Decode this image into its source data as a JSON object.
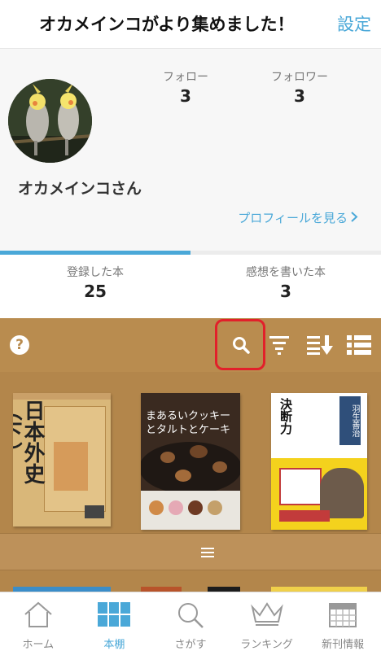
{
  "header": {
    "title": "オカメインコがより集めました！",
    "settings_label": "設定"
  },
  "profile": {
    "avatar_icon": "cockatiel-avatar-icon",
    "follow": {
      "label": "フォロー",
      "count": "3"
    },
    "follower": {
      "label": "フォロワー",
      "count": "3"
    },
    "username": "オカメインコさん",
    "profile_link": "プロフィールを見る"
  },
  "tabs": [
    {
      "label": "登録した本",
      "count": "25"
    },
    {
      "label": "感想を書いた本",
      "count": "3"
    }
  ],
  "toolbar": {
    "help": "?",
    "icons": [
      "help-icon",
      "search-icon",
      "filter-icon",
      "sort-icon",
      "list-view-icon"
    ]
  },
  "books": [
    {
      "title": "日本外史（下）",
      "label": "岩波文庫"
    },
    {
      "title": "まあるいクッキーとタルトとケーキ"
    },
    {
      "title": "決断力",
      "author": "羽生善治"
    }
  ],
  "bottom_nav": [
    {
      "label": "ホーム",
      "icon": "home-icon"
    },
    {
      "label": "本棚",
      "icon": "bookshelf-icon",
      "active": true
    },
    {
      "label": "さがす",
      "icon": "search-icon"
    },
    {
      "label": "ランキング",
      "icon": "crown-icon"
    },
    {
      "label": "新刊情報",
      "icon": "calendar-icon"
    }
  ],
  "colors": {
    "accent": "#4aa8d8",
    "shelf": "#b3864b",
    "highlight": "#e2202a"
  }
}
